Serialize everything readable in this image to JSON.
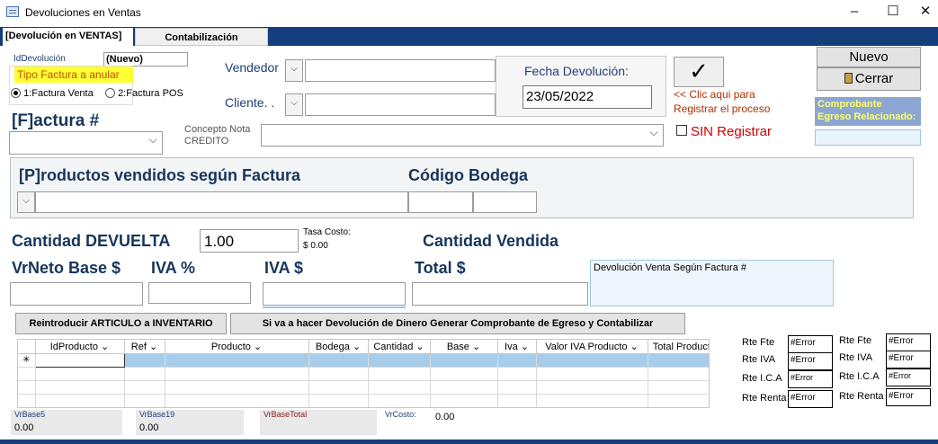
{
  "window": {
    "title": "Devoluciones en Ventas",
    "minimize": "–",
    "maximize": "☐",
    "close": "✕"
  },
  "tabs": [
    {
      "label": "[Devolución en VENTAS]",
      "active": true
    },
    {
      "label": "Contabilización",
      "active": false
    }
  ],
  "header": {
    "id_label": "IdDevolución",
    "id_value": "(Nuevo)",
    "tipo_label": "Tipo Factura a anular",
    "radio1": "1:Factura Venta",
    "radio2": "2:Factura POS",
    "vendedor_label": "Vendedor",
    "cliente_label": "Cliente. .",
    "fecha_label": "Fecha Devolución:",
    "fecha_value": "23/05/2022",
    "check_symbol": "✓",
    "register_hint_1": "<< Clic aqui para",
    "register_hint_2": "Registrar el proceso",
    "sin_registrar": "SIN Registrar",
    "nuevo": "Nuevo",
    "cerrar": "Cerrar",
    "comprobante_1": "Comprobante",
    "comprobante_2": "Egreso Relacionado:",
    "factura_label": "[F]actura #",
    "concepto_1": "Concepto Nota",
    "concepto_2": "CREDITO"
  },
  "products": {
    "title": "[P]roductos vendidos según Factura",
    "bodega_label": "Código Bodega",
    "cantidad_devuelta_label": "Cantidad DEVUELTA",
    "cantidad_devuelta_value": "1.00",
    "tasa_label": "Tasa Costo:",
    "tasa_value": "$ 0.00",
    "cantidad_vendida_label": "Cantidad Vendida",
    "vrneto_label": "VrNeto Base $",
    "iva_pct_label": "IVA %",
    "iva_label": "IVA $",
    "total_label": "Total $",
    "memo": "Devolución Venta  Según Factura #"
  },
  "buttons": {
    "reintroducir": "Reintroducir ARTICULO a INVENTARIO",
    "egreso": "Si va a hacer Devolución de Dinero Generar Comprobante de Egreso y Contabilizar"
  },
  "grid": {
    "columns": [
      "IdProducto",
      "Ref",
      "Producto",
      "Bodega",
      "Cantidad",
      "Base",
      "Iva",
      "Valor IVA Producto",
      "Total Producto"
    ],
    "new_row_marker": "✳"
  },
  "retenciones": {
    "left": [
      {
        "label": "Rte Fte",
        "value": "#Error"
      },
      {
        "label": "Rte IVA",
        "value": "#Error"
      },
      {
        "label": "Rte I.C.A",
        "value": "#Error"
      },
      {
        "label": "Rte Renta",
        "value": "#Error"
      }
    ],
    "right": [
      {
        "label": "Rte Fte",
        "value": "#Error"
      },
      {
        "label": "Rte IVA",
        "value": "#Error"
      },
      {
        "label": "Rte I.C.A",
        "value": "#Error"
      },
      {
        "label": "Rte Renta",
        "value": "#Error"
      }
    ]
  },
  "footer": {
    "vrbase5_label": "VrBase5",
    "vrbase5_value": "0.00",
    "vrbase19_label": "VrBase19",
    "vrbase19_value": "0.00",
    "vrbasetotal_label": "VrBaseTotal",
    "vrcosto_label": "VrCosto:",
    "vrcosto_value": "0.00"
  }
}
